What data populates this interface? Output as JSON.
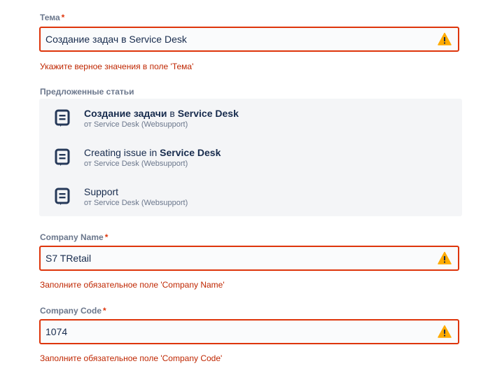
{
  "topic": {
    "label": "Тема",
    "required_mark": "*",
    "value": "Создание задач в Service Desk",
    "error": "Укажите верное значения в поле 'Тема'"
  },
  "suggested": {
    "label": "Предложенные статьи",
    "articles": [
      {
        "title_bold_1": "Создание задачи",
        "title_mid": " в ",
        "title_bold_2": "Service Desk",
        "source": "от Service Desk (Websupport)",
        "icon": "article-icon"
      },
      {
        "title_pre": "Creating issue in ",
        "title_bold": "Service Desk",
        "source": "от Service Desk (Websupport)",
        "icon": "article-icon"
      },
      {
        "title": "Support",
        "source": "от Service Desk (Websupport)",
        "icon": "article-icon"
      }
    ]
  },
  "company_name": {
    "label": "Company Name",
    "required_mark": "*",
    "value": "S7 TRetail",
    "error": "Заполните обязательное поле 'Company Name'"
  },
  "company_code": {
    "label": "Company Code",
    "required_mark": "*",
    "value": "1074",
    "error": "Заполните обязательное поле 'Company Code'"
  },
  "colors": {
    "error": "#de350b",
    "error_text": "#bf2600",
    "warning_icon": "#ffab00",
    "label": "#6b778c",
    "text": "#172b4d",
    "panel": "#f4f5f7"
  },
  "icons": {
    "warning": "warning-icon"
  }
}
